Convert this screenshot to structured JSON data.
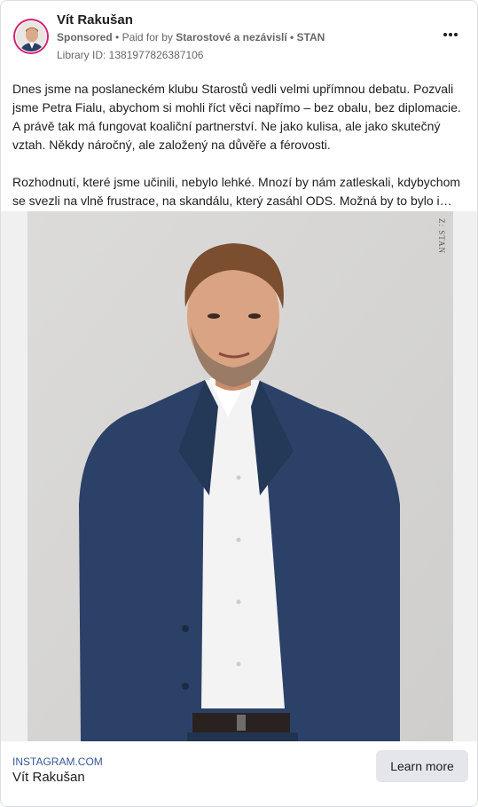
{
  "post": {
    "author_name": "Vít Rakušan",
    "sponsored_label": "Sponsored",
    "paid_for_prefix": "Paid for by",
    "paid_for_by": "Starostové a nezávislí • STAN",
    "library_id": "Library ID: 1381977826387106",
    "more_icon": "more-horizontal-icon"
  },
  "body": {
    "paragraphs": [
      "Dnes jsme na poslaneckém klubu Starostů vedli velmi upřímnou debatu. Pozvali jsme Petra Fialu, abychom si mohli říct věci napřímo – bez obalu, bez diplomacie. A právě tak má fungovat koaliční partnerství. Ne jako kulisa, ale jako skutečný vztah. Někdy náročný, ale založený na důvěře a férovosti.",
      "Rozhodnutí, které jsme učinili, nebylo lehké. Mnozí by nám zatleskali, kdybychom se svezli na vlně frustrace, na skandálu, který zasáhl ODS. Možná by to bylo i…"
    ]
  },
  "media": {
    "watermark": "Z: STAN"
  },
  "footer": {
    "domain": "INSTAGRAM.COM",
    "title": "Vít Rakušan",
    "cta_label": "Learn more"
  },
  "colors": {
    "avatar_ring": "#d4236f",
    "link_blue": "#385898",
    "suit_blue": "#2a3f66"
  }
}
